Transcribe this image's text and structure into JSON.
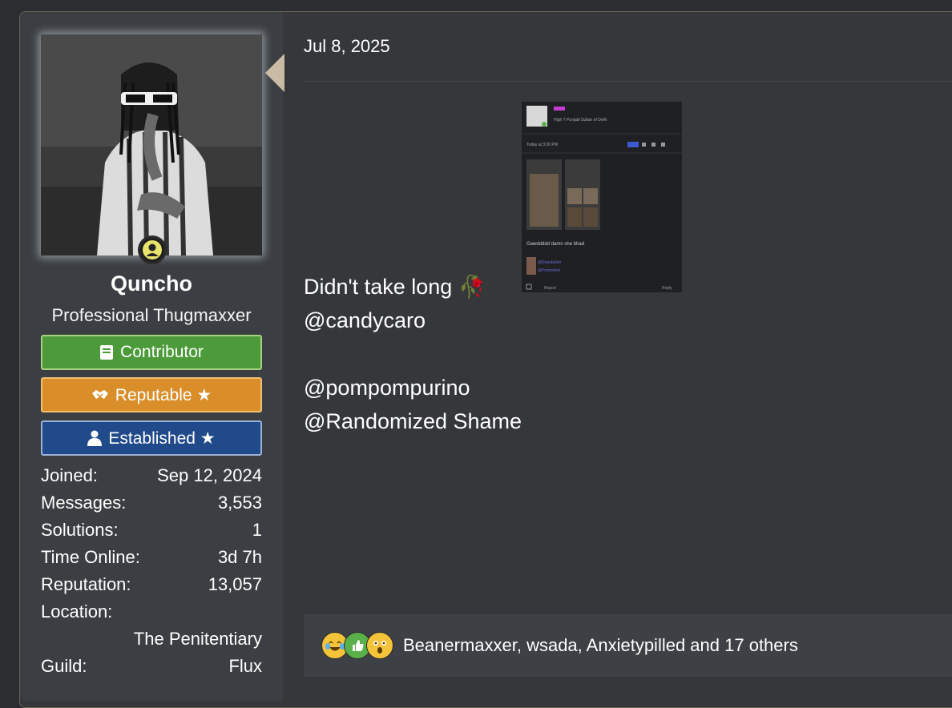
{
  "post": {
    "date": "Jul 8, 2025",
    "lines": [
      {
        "text": "Didn't take long",
        "emoji": "🥀"
      },
      {
        "text": "@candycaro"
      },
      {
        "text": ""
      },
      {
        "text": "@pompompurino"
      },
      {
        "text": "@Randomized Shame"
      }
    ],
    "embed": {
      "user_line": "High T Punjabi Sultan of Delhi",
      "time": "Today at 3:26 PM",
      "caption": "Gawddddd damn she bhad",
      "mention_a": "@Reputation",
      "mention_b": "@Pomodoro",
      "report": "Report",
      "reply": "Reply"
    }
  },
  "user": {
    "name": "Quncho",
    "title": "Professional Thugmaxxer",
    "banners": [
      {
        "label": "Contributor",
        "icon": "book-icon",
        "color": "#4c9a3a"
      },
      {
        "label": "Reputable ★",
        "icon": "handshake-icon",
        "color": "#d98e2a"
      },
      {
        "label": "Established ★",
        "icon": "person-icon",
        "color": "#214a8a"
      }
    ],
    "stats": {
      "joined_label": "Joined:",
      "joined": "Sep 12, 2024",
      "messages_label": "Messages:",
      "messages": "3,553",
      "solutions_label": "Solutions:",
      "solutions": "1",
      "time_label": "Time Online:",
      "time": "3d 7h",
      "rep_label": "Reputation:",
      "rep": "13,057",
      "location_label": "Location:",
      "location": "The Penitentiary",
      "guild_label": "Guild:",
      "guild": "Flux"
    }
  },
  "reactions": {
    "icons": [
      "laughing-crying-icon",
      "thumbs-up-icon",
      "shocked-icon"
    ],
    "text": "Beanermaxxer, wsada, Anxietypilled and 17 others"
  }
}
